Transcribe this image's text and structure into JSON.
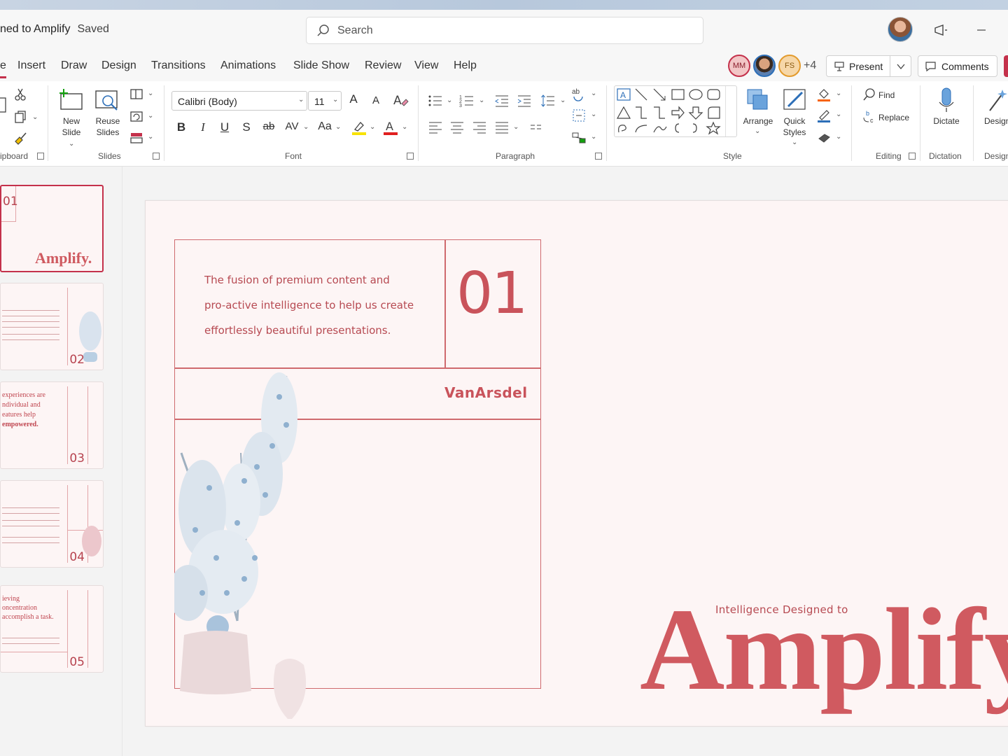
{
  "window": {
    "title": "ned to Amplify",
    "save_status": "Saved",
    "search_placeholder": "Search"
  },
  "tabs": [
    "e",
    "Insert",
    "Draw",
    "Design",
    "Transitions",
    "Animations",
    "Slide Show",
    "Review",
    "View",
    "Help"
  ],
  "collaborators": {
    "mm": "MM",
    "fs": "FS",
    "more": "+4"
  },
  "actions": {
    "present": "Present",
    "comments": "Comments"
  },
  "ribbon": {
    "clipboard_label": "ipboard",
    "slides": {
      "new_slide": "New Slide",
      "reuse_slides": "Reuse Slides",
      "label": "Slides"
    },
    "font": {
      "family": "Calibri (Body)",
      "size": "11",
      "label": "Font",
      "bold": "B",
      "italic": "I",
      "underline": "U",
      "shadow": "S",
      "strike": "ab",
      "spacing": "AV",
      "case": "Aa",
      "grow": "A",
      "shrink": "A"
    },
    "paragraph_label": "Paragraph",
    "style": {
      "arrange": "Arrange",
      "quick_styles": "Quick Styles",
      "label": "Style"
    },
    "editing": {
      "find": "Find",
      "replace": "Replace",
      "label": "Editing"
    },
    "dictation": {
      "dictate": "Dictate",
      "label": "Dictation"
    },
    "designer": {
      "button": "Design",
      "label": "Design"
    }
  },
  "thumbnails": [
    {
      "num": "01",
      "title": "Amplify."
    },
    {
      "num": "02"
    },
    {
      "num": "03",
      "text": [
        "experiences are",
        "ndividual and",
        "eatures help",
        "empowered."
      ]
    },
    {
      "num": "04"
    },
    {
      "num": "05",
      "text": [
        "ieving",
        "oncentration",
        "accomplish a task."
      ]
    }
  ],
  "slide": {
    "body": [
      "The fusion of premium content and",
      "pro-active intelligence to help us create",
      "effortlessly beautiful presentations."
    ],
    "number": "01",
    "brand": "VanArsdel",
    "tagline": "Intelligence Designed to",
    "hero": "Amplify"
  },
  "colors": {
    "accent": "#c4314b",
    "slide_text": "#c9535b",
    "slide_bg": "#fdf5f5"
  }
}
